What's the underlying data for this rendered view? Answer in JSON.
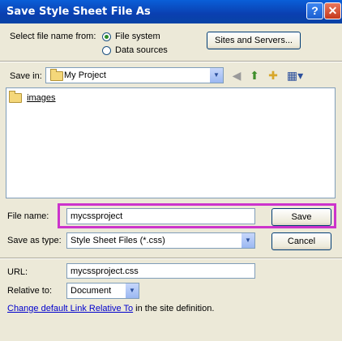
{
  "window": {
    "title": "Save Style Sheet File As",
    "help_glyph": "?",
    "close_glyph": "✕"
  },
  "select_from": {
    "label": "Select file name from:",
    "options": [
      "File system",
      "Data sources"
    ],
    "selected": "File system",
    "sites_button": "Sites and Servers..."
  },
  "save_in": {
    "label": "Save in:",
    "value": "My Project"
  },
  "toolbar_icons": [
    "back-icon",
    "up-folder-icon",
    "new-folder-icon",
    "view-menu-icon"
  ],
  "files": [
    {
      "name": "images",
      "type": "folder"
    }
  ],
  "file_name": {
    "label": "File name:",
    "value": "mycssproject",
    "save_button": "Save"
  },
  "save_as_type": {
    "label": "Save as type:",
    "value": "Style Sheet Files (*.css)",
    "cancel_button": "Cancel"
  },
  "url": {
    "label": "URL:",
    "value": "mycssproject.css"
  },
  "relative_to": {
    "label": "Relative to:",
    "value": "Document"
  },
  "footer": {
    "link_text": "Change default Link Relative To",
    "suffix": " in the site definition."
  },
  "colors": {
    "title_bar": "#0a5fd8",
    "dialog_bg": "#ece9d8",
    "highlight": "#cc33cc"
  }
}
